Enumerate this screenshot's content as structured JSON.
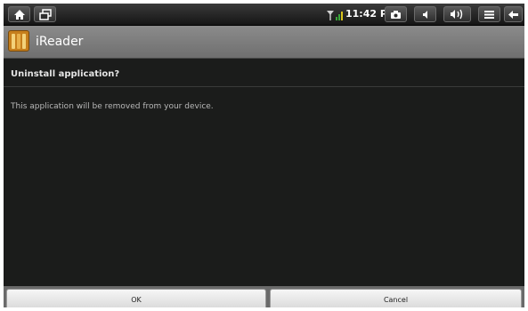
{
  "status_bar": {
    "time": "11:42 PM",
    "left_buttons": [
      {
        "icon": "home-icon"
      },
      {
        "icon": "recent-apps-icon"
      }
    ],
    "right_buttons": [
      {
        "icon": "camera-icon"
      },
      {
        "icon": "volume-down-icon"
      },
      {
        "icon": "volume-up-icon"
      },
      {
        "icon": "menu-icon"
      },
      {
        "icon": "back-icon"
      }
    ]
  },
  "app": {
    "title": "iReader",
    "icon": "ireader-books-icon",
    "icon_color": "#c67f1c"
  },
  "dialog": {
    "heading": "Uninstall application?",
    "message": "This application will be removed from your device.",
    "ok_label": "OK",
    "cancel_label": "Cancel"
  },
  "colors": {
    "background": "#1b1c1b",
    "titlebar": "#7c7c7c",
    "heading_text": "#e4e4e4",
    "message_text": "#b8b8b8"
  }
}
